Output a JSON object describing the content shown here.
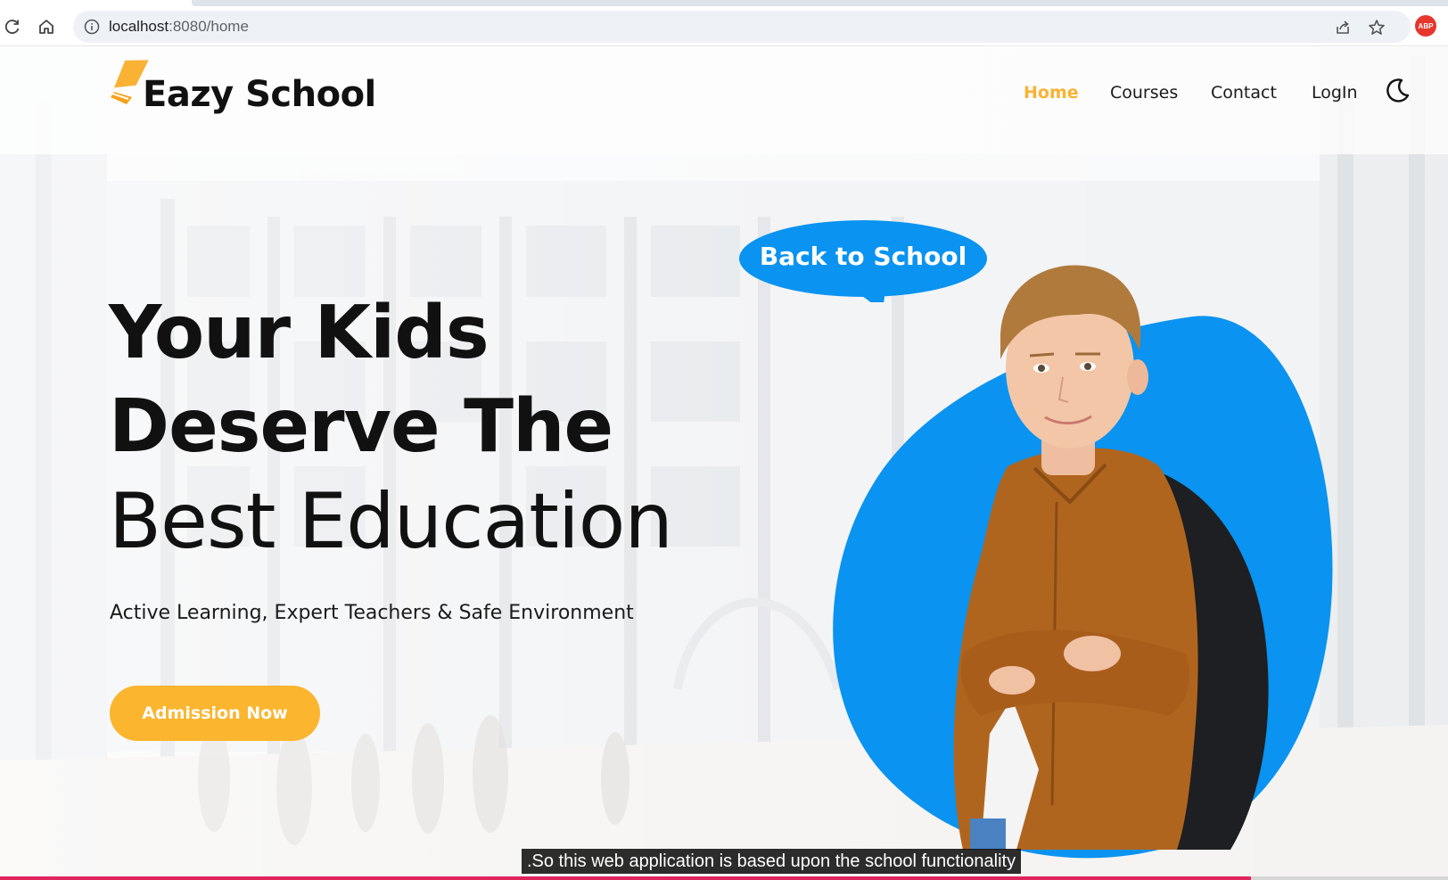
{
  "browser": {
    "url_host": "localhost",
    "url_path": ":8080/home",
    "extension_badge": "ABP"
  },
  "site": {
    "logo_text": "Eazy School",
    "accent_color": "#f9b233",
    "brand_blue": "#0a93f0",
    "nav": [
      {
        "label": "Home",
        "active": true
      },
      {
        "label": "Courses",
        "active": false
      },
      {
        "label": "Contact",
        "active": false
      },
      {
        "label": "LogIn",
        "active": false
      }
    ],
    "theme_toggle_icon": "moon-icon"
  },
  "hero": {
    "line1": "Your Kids",
    "line2": "Deserve The",
    "line3": "Best Education",
    "subtitle": "Active Learning, Expert Teachers & Safe Environment",
    "cta_label": "Admission Now",
    "bubble_text": "Back to School"
  },
  "video": {
    "caption": ".So this web application is based upon the school functionality",
    "progress_fraction": 0.864
  }
}
